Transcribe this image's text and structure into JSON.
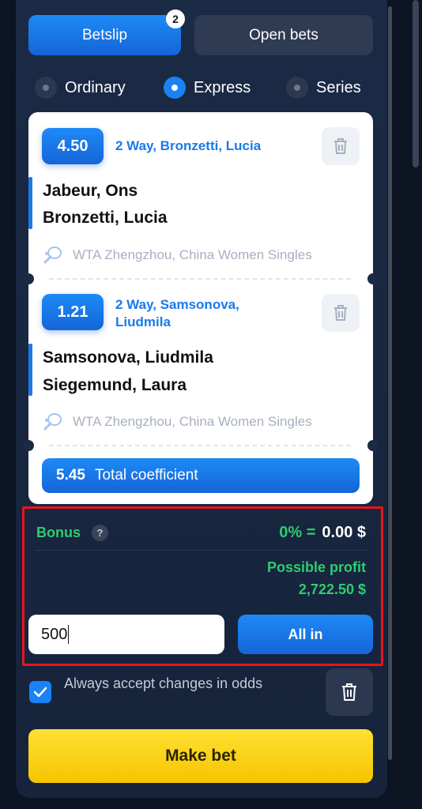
{
  "tabs": {
    "betslip_label": "Betslip",
    "betslip_count": "2",
    "open_bets_label": "Open bets"
  },
  "bet_types": [
    {
      "label": "Ordinary",
      "selected": false
    },
    {
      "label": "Express",
      "selected": true
    },
    {
      "label": "Series",
      "selected": false
    }
  ],
  "bets": [
    {
      "odds": "4.50",
      "market": "2 Way, Bronzetti, Lucia",
      "team1": "Jabeur, Ons",
      "team2": "Bronzetti, Lucia",
      "league": "WTA Zhengzhou, China Women Singles",
      "sport_icon": "tennis-icon"
    },
    {
      "odds": "1.21",
      "market_line1": "2 Way, Samsonova,",
      "market_line2": "Liudmila",
      "team1": "Samsonova, Liudmila",
      "team2": "Siegemund, Laura",
      "league": "WTA Zhengzhou, China Women Singles",
      "sport_icon": "tennis-icon"
    }
  ],
  "total": {
    "value": "5.45",
    "label": "Total coefficient"
  },
  "bonus": {
    "label": "Bonus",
    "help": "?",
    "percent": "0% =",
    "amount": "0.00 $"
  },
  "profit": {
    "label": "Possible profit",
    "value": "2,722.50 $"
  },
  "stake": {
    "value": "500"
  },
  "all_in_label": "All in",
  "accept_changes": {
    "checked": true,
    "label": "Always accept changes in odds"
  },
  "make_bet_label": "Make bet",
  "colors": {
    "accent_blue": "#1a7ae8",
    "profit_green": "#2ecc71",
    "highlight_red": "#e8141d",
    "make_bet_yellow": "#f6c400"
  }
}
